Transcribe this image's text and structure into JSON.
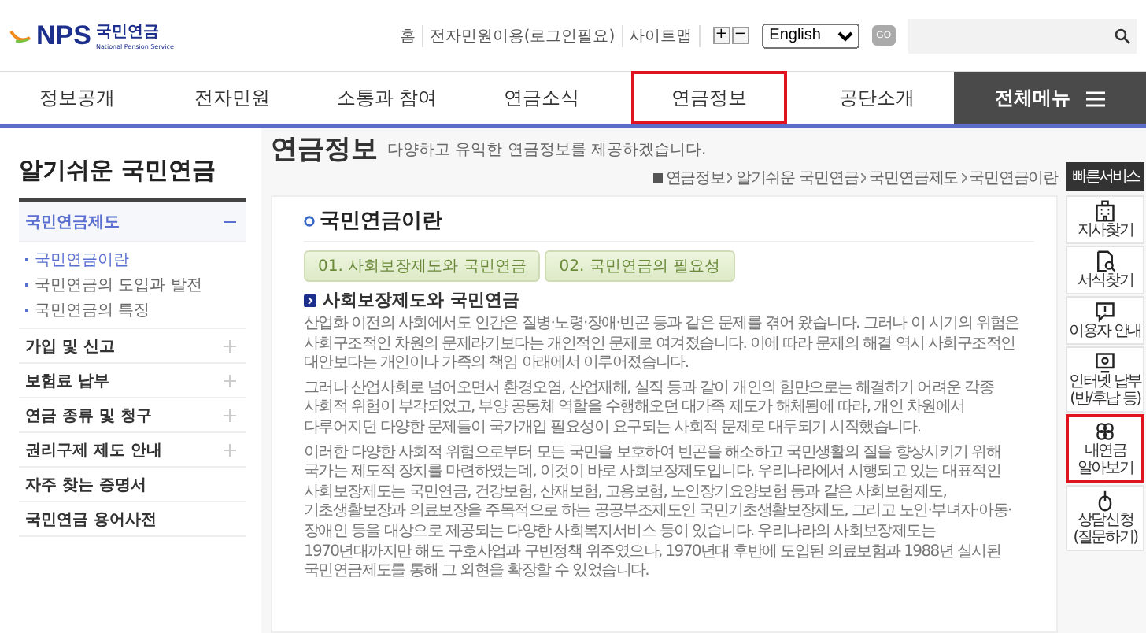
{
  "logo": {
    "mark": "NPS",
    "name": "국민연금",
    "subtitle": "National Pension Service"
  },
  "util_links": [
    "홈",
    "전자민원이용(로그인필요)",
    "사이트맵"
  ],
  "font_buttons": [
    "+",
    "−"
  ],
  "language_select": {
    "value": "English"
  },
  "go_button": "GO",
  "nav": [
    {
      "label": "정보공개",
      "selected": false
    },
    {
      "label": "전자민원",
      "selected": false
    },
    {
      "label": "소통과 참여",
      "selected": false
    },
    {
      "label": "연금소식",
      "selected": false
    },
    {
      "label": "연금정보",
      "selected": true
    },
    {
      "label": "공단소개",
      "selected": false
    }
  ],
  "all_menu": "전체메뉴",
  "sidebar": {
    "title": "알기쉬운 국민연금",
    "items": [
      {
        "label": "국민연금제도",
        "kind": "group",
        "expanded": true,
        "children": [
          {
            "label": "국민연금이란",
            "selected": true
          },
          {
            "label": "국민연금의 도입과 발전",
            "selected": false
          },
          {
            "label": "국민연금의 특징",
            "selected": false
          }
        ]
      },
      {
        "label": "가입 및 신고",
        "kind": "group",
        "expanded": false
      },
      {
        "label": "보험료 납부",
        "kind": "group",
        "expanded": false
      },
      {
        "label": "연금 종류 및 청구",
        "kind": "group",
        "expanded": false
      },
      {
        "label": "권리구제 제도 안내",
        "kind": "group",
        "expanded": false
      },
      {
        "label": "자주 찾는 증명서",
        "kind": "link",
        "expanded": false
      },
      {
        "label": "국민연금 용어사전",
        "kind": "link",
        "expanded": false
      }
    ]
  },
  "page": {
    "title": "연금정보",
    "subtitle": "다양하고 유익한 연금정보를 제공하겠습니다.",
    "breadcrumb": [
      "연금정보",
      "알기쉬운 국민연금",
      "국민연금제도",
      "국민연금이란"
    ],
    "heading": "국민연금이란",
    "tabs": [
      "01. 사회보장제도와 국민연금",
      "02. 국민연금의 필요성"
    ],
    "section_title": "사회보장제도와 국민연금",
    "paragraphs": [
      "산업화 이전의 사회에서도 인간은 질병·노령·장애·빈곤 등과 같은 문제를 겪어 왔습니다. 그러나 이 시기의 위험은 사회구조적인 차원의 문제라기보다는 개인적인 문제로 여겨졌습니다. 이에 따라 문제의 해결 역시 사회구조적인 대안보다는 개인이나 가족의 책임 아래에서 이루어졌습니다.",
      "그러나 산업사회로 넘어오면서 환경오염, 산업재해, 실직 등과 같이 개인의 힘만으로는 해결하기 어려운 각종 사회적 위험이 부각되었고, 부양 공동체 역할을 수행해오던 대가족 제도가 해체됨에 따라, 개인 차원에서 다루어지던 다양한 문제들이 국가개입 필요성이 요구되는 사회적 문제로 대두되기 시작했습니다.",
      "이러한 다양한 사회적 위험으로부터 모든 국민을 보호하여 빈곤을 해소하고 국민생활의 질을 향상시키기 위해 국가는 제도적 장치를 마련하였는데, 이것이 바로 사회보장제도입니다. 우리나라에서 시행되고 있는 대표적인 사회보장제도는 국민연금, 건강보험, 산재보험, 고용보험, 노인장기요양보험 등과 같은 사회보험제도, 기초생활보장과 의료보장을 주목적으로 하는 공공부조제도인 국민기초생활보장제도, 그리고 노인·부녀자·아동·장애인 등을 대상으로 제공되는 다양한 사회복지서비스 등이 있습니다. 우리나라의 사회보장제도는 1970년대까지만 해도 구호사업과 구빈정책 위주였으나, 1970년대 후반에 도입된 의료보험과 1988년 실시된 국민연금제도를 통해 그 외현을 확장할 수 있었습니다."
    ]
  },
  "quick": {
    "title": "빠른서비스",
    "items": [
      {
        "label": "지사찾기",
        "kind": "building",
        "selected": false
      },
      {
        "label": "서식찾기",
        "kind": "document",
        "selected": false
      },
      {
        "label": "이용자 안내",
        "kind": "notice",
        "selected": false
      },
      {
        "label": "인터넷 납부(반/후납 등)",
        "kind": "monitor",
        "selected": false
      },
      {
        "label": "내연금 알아보기",
        "kind": "clover",
        "selected": true
      },
      {
        "label": "상담신청(질문하기)",
        "kind": "mouse",
        "selected": false
      }
    ]
  }
}
